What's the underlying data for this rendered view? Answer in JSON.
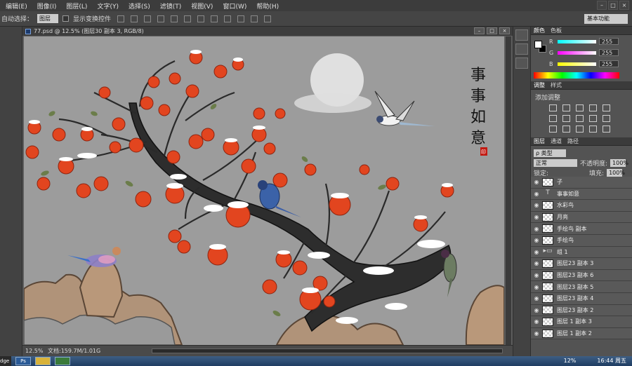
{
  "menubar": {
    "items": [
      "编辑(E)",
      "图像(I)",
      "图层(L)",
      "文字(Y)",
      "选择(S)",
      "滤镜(T)",
      "视图(V)",
      "窗口(W)",
      "帮助(H)"
    ],
    "window_buttons": [
      "–",
      "□",
      "×"
    ]
  },
  "options": {
    "auto_select_label": "自动选择：",
    "auto_select_value": "图层",
    "show_transform_label": "显示变换控件",
    "workspace": "基本功能"
  },
  "document": {
    "tab_title": "77.psd @ 12.5% (图层30 副本 3, RGB/8)",
    "buttons": [
      "–",
      "□",
      "×"
    ],
    "zoom": "12.5%",
    "doc_size": "文档:159.7M/1.01G"
  },
  "artwork": {
    "calligraphy": [
      "事",
      "事",
      "如",
      "意"
    ],
    "seal": "印"
  },
  "color_panel": {
    "tabs": [
      "颜色",
      "色板"
    ],
    "r_label": "R",
    "g_label": "G",
    "b_label": "B",
    "r": "255",
    "g": "255",
    "b": "255"
  },
  "adjustments_panel": {
    "tabs": [
      "调整",
      "样式"
    ],
    "add_label": "添加调整"
  },
  "layers_panel": {
    "tabs": [
      "图层",
      "通道",
      "路径"
    ],
    "filter_kind": "ρ 类型",
    "blend_mode": "正常",
    "opacity_label": "不透明度:",
    "opacity": "100%",
    "lock_label": "锁定:",
    "fill_label": "填充:",
    "fill": "100%",
    "layers": [
      {
        "name": "子",
        "kind": "pixel"
      },
      {
        "name": "事事如意",
        "kind": "text"
      },
      {
        "name": "水彩鸟",
        "kind": "pixel"
      },
      {
        "name": "月亮",
        "kind": "pixel"
      },
      {
        "name": "手绘鸟 副本",
        "kind": "pixel"
      },
      {
        "name": "手绘鸟",
        "kind": "pixel"
      },
      {
        "name": "组 1",
        "kind": "group"
      },
      {
        "name": "图层23 副本 3",
        "kind": "pixel"
      },
      {
        "name": "图层23 副本 6",
        "kind": "pixel"
      },
      {
        "name": "图层23 副本 5",
        "kind": "pixel"
      },
      {
        "name": "图层23 副本 4",
        "kind": "pixel"
      },
      {
        "name": "图层23 副本 2",
        "kind": "pixel"
      },
      {
        "name": "图层 1 副本 3",
        "kind": "pixel"
      },
      {
        "name": "图层 1 副本 2",
        "kind": "pixel"
      }
    ]
  },
  "taskbar": {
    "edge_label": "dge",
    "ps_label": "Ps",
    "battery": "12%",
    "clock": "16:44 周五"
  }
}
